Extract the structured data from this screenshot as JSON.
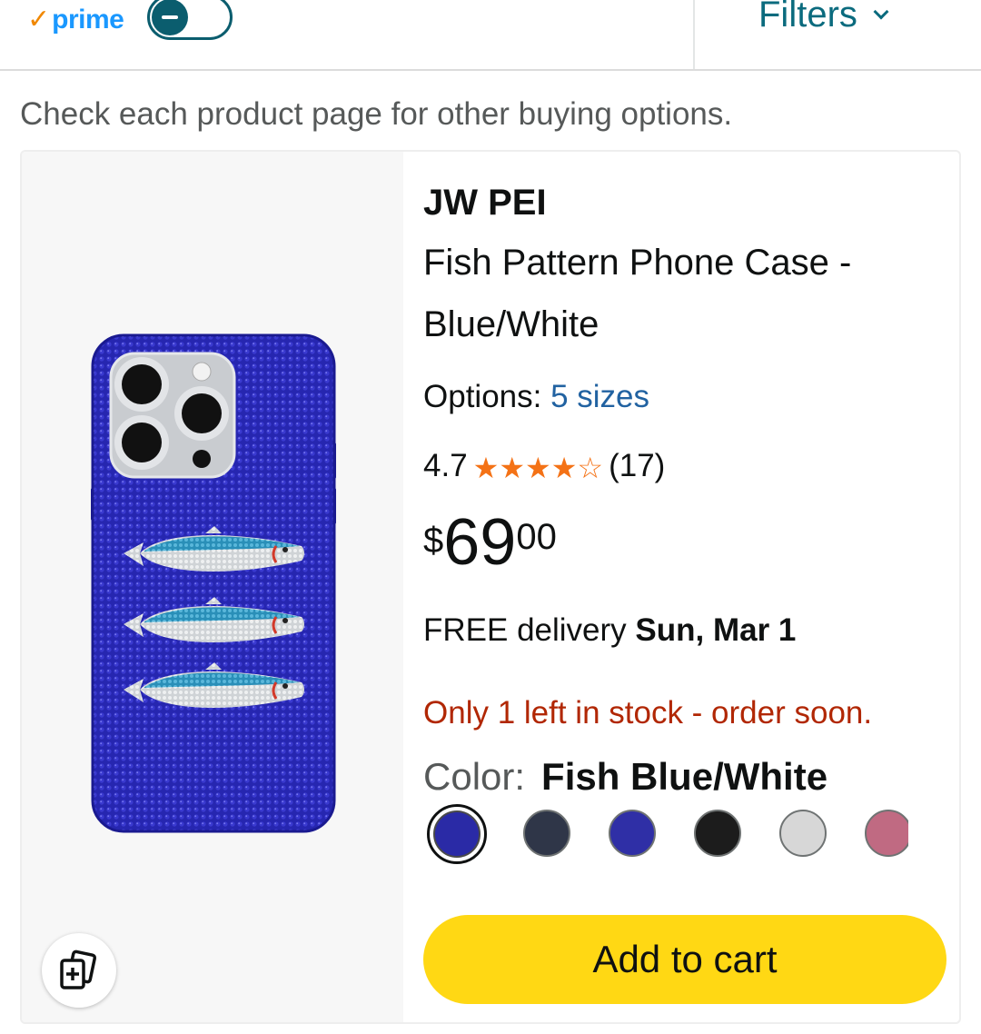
{
  "header": {
    "prime_check": "✓",
    "prime_label": "prime",
    "prime_toggle_state": "off",
    "filters_label": "Filters"
  },
  "notice": "Check each product page for other buying options.",
  "product": {
    "brand": "JW PEI",
    "title": "Fish Pattern Phone Case - Blue/White",
    "options_label": "Options:",
    "options_link": "5 sizes",
    "rating_value": "4.7",
    "rating_stars": 4.5,
    "rating_count": "(17)",
    "price_symbol": "$",
    "price_whole": "69",
    "price_fraction": "00",
    "delivery_prefix": "FREE delivery",
    "delivery_date": "Sun, Mar 1",
    "stock_message": "Only 1 left in stock - order soon.",
    "color_label": "Color:",
    "color_value": "Fish Blue/White",
    "swatches": [
      {
        "color": "#2a2aa6",
        "selected": true
      },
      {
        "color": "#2f3648",
        "selected": false
      },
      {
        "color": "#2f2fa6",
        "selected": false
      },
      {
        "color": "#1c1c1c",
        "selected": false
      },
      {
        "color": "#d7d7d7",
        "selected": false
      },
      {
        "color": "#c06a82",
        "selected": false
      }
    ],
    "add_to_cart_label": "Add to cart"
  },
  "colors": {
    "accent_teal": "#0b6b7e",
    "link_blue": "#2162a1",
    "star_orange": "#f47216",
    "stock_red": "#b12704",
    "cart_yellow": "#ffd814",
    "case_blue": "#2a2ab8"
  },
  "icons": {
    "save": "add-to-list-icon",
    "filters": "chevron-down-icon"
  }
}
